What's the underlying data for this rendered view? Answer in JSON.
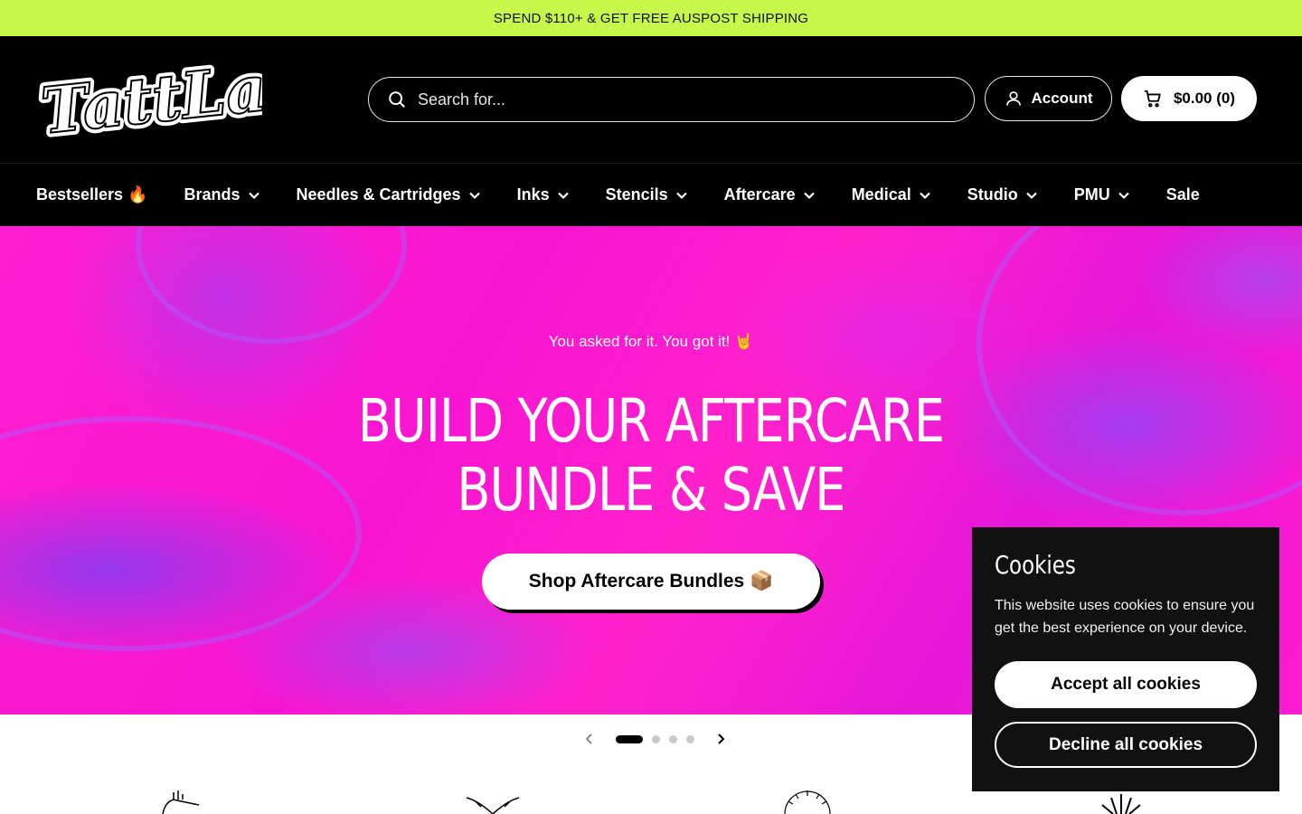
{
  "announcement": {
    "text": "SPEND $110+ & GET FREE AUSPOST SHIPPING"
  },
  "header": {
    "logo_text": "TattLab",
    "search": {
      "placeholder": "Search for..."
    },
    "account_label": "Account",
    "cart_label": "$0.00 (0)"
  },
  "nav": {
    "items": [
      {
        "label": "Bestsellers 🔥",
        "dropdown": false
      },
      {
        "label": "Brands",
        "dropdown": true
      },
      {
        "label": "Needles & Cartridges",
        "dropdown": true
      },
      {
        "label": "Inks",
        "dropdown": true
      },
      {
        "label": "Stencils",
        "dropdown": true
      },
      {
        "label": "Aftercare",
        "dropdown": true
      },
      {
        "label": "Medical",
        "dropdown": true
      },
      {
        "label": "Studio",
        "dropdown": true
      },
      {
        "label": "PMU",
        "dropdown": true
      },
      {
        "label": "Sale",
        "dropdown": false
      }
    ]
  },
  "hero": {
    "subtitle": "You asked for it. You got it! 🤘",
    "title": "BUILD YOUR AFTERCARE BUNDLE & SAVE",
    "cta_label": "Shop Aftercare Bundles 📦",
    "slides_total": 4,
    "active_slide": 1
  },
  "cookie_banner": {
    "title": "Cookies",
    "text": "This website uses cookies to ensure you get the best experience on your device.",
    "accept_label": "Accept all cookies",
    "decline_label": "Decline all cookies"
  },
  "colors": {
    "announcement_bg": "#c6f74a",
    "header_bg": "#000000",
    "hero_pink": "#ff1ed0",
    "hero_purple": "#8a3cf0",
    "cookie_bg": "#111111"
  }
}
